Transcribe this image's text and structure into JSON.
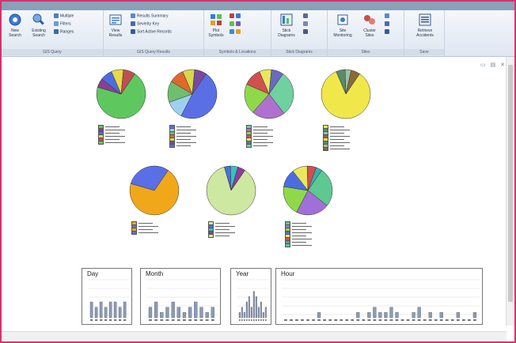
{
  "ribbon": {
    "groups": [
      {
        "label": "GIS Query",
        "buttons": [
          {
            "label": "New Search",
            "icon": "new-search-icon"
          },
          {
            "label": "Existing Search",
            "icon": "existing-search-icon"
          }
        ],
        "small": [
          "Multiple",
          "Filters",
          "Ranges"
        ]
      },
      {
        "label": "GIS Query Results",
        "buttons": [
          {
            "label": "View Results",
            "icon": "view-results-icon"
          }
        ],
        "small": [
          "Results Summary",
          "Severity Key",
          "Sort Active Records"
        ]
      },
      {
        "label": "Symbols & Locations",
        "buttons": [
          {
            "label": "Plot Symbols",
            "icon": "plot-symbols-icon"
          }
        ]
      },
      {
        "label": "Stick Diagrams",
        "buttons": [
          {
            "label": "Stick Diagrams",
            "icon": "stick-diagrams-icon"
          }
        ]
      },
      {
        "label": "Sites",
        "buttons": [
          {
            "label": "Site Monitoring",
            "icon": "site-monitoring-icon"
          },
          {
            "label": "Cluster Sites",
            "icon": "cluster-sites-icon"
          }
        ]
      },
      {
        "label": "Save",
        "buttons": [
          {
            "label": "Retrieve Accidents",
            "icon": "retrieve-accidents-icon"
          }
        ]
      }
    ]
  },
  "window_controls": "▭ ▤ ✕",
  "colors": {
    "frame": "#d6336c",
    "ribbon_top": "#8aa0b8"
  },
  "chart_data": [
    {
      "type": "pie",
      "values": [
        70,
        6,
        8,
        8,
        8
      ],
      "colors": [
        "#5ec85e",
        "#8b3f8f",
        "#4a6ee0",
        "#e8d84a",
        "#c05050"
      ]
    },
    {
      "type": "pie",
      "values": [
        48,
        12,
        14,
        10,
        8,
        8
      ],
      "colors": [
        "#5a6fe6",
        "#9fd0f0",
        "#6fbf6f",
        "#e0682b",
        "#d8d84a",
        "#7a4a9a"
      ]
    },
    {
      "type": "pie",
      "values": [
        30,
        22,
        20,
        12,
        8,
        8
      ],
      "colors": [
        "#6fd0a0",
        "#b070d0",
        "#8fd84a",
        "#d05050",
        "#e8e860",
        "#6a6ac0"
      ]
    },
    {
      "type": "pie",
      "values": [
        84,
        6,
        4,
        6
      ],
      "colors": [
        "#f0e84a",
        "#5a8a6a",
        "#a0c0a0",
        "#8a6a3a"
      ]
    },
    {
      "type": "pie",
      "values": [
        70,
        30
      ],
      "colors": [
        "#f0a81a",
        "#5a6fe6"
      ]
    },
    {
      "type": "pie",
      "values": [
        86,
        4,
        5,
        5
      ],
      "colors": [
        "#cde8a0",
        "#4a6ee0",
        "#3ac0c0",
        "#8a3f9a"
      ]
    },
    {
      "type": "pie",
      "values": [
        26,
        22,
        20,
        12,
        10,
        6,
        4
      ],
      "colors": [
        "#5ec890",
        "#a070d8",
        "#8fd84a",
        "#4a6ee0",
        "#e8e860",
        "#d05050",
        "#3ab0b0"
      ]
    }
  ],
  "histograms": [
    {
      "title": "Day",
      "values": [
        3,
        2,
        3,
        2,
        3,
        3,
        2,
        3
      ]
    },
    {
      "title": "Month",
      "values": [
        2,
        3,
        1,
        2,
        3,
        2,
        1,
        2,
        3,
        2,
        1,
        2
      ]
    },
    {
      "title": "Year",
      "values": [
        1,
        2,
        1,
        3,
        4,
        2,
        5,
        4,
        2,
        3,
        1,
        2
      ]
    },
    {
      "title": "Hour",
      "values": [
        0,
        0,
        0,
        0,
        0,
        0,
        1,
        0,
        0,
        0,
        0,
        0,
        0,
        1,
        0,
        1,
        2,
        1,
        1,
        2,
        1,
        0,
        0,
        1,
        2,
        0,
        1,
        0,
        1,
        0,
        0,
        1,
        0,
        0,
        1
      ]
    }
  ]
}
